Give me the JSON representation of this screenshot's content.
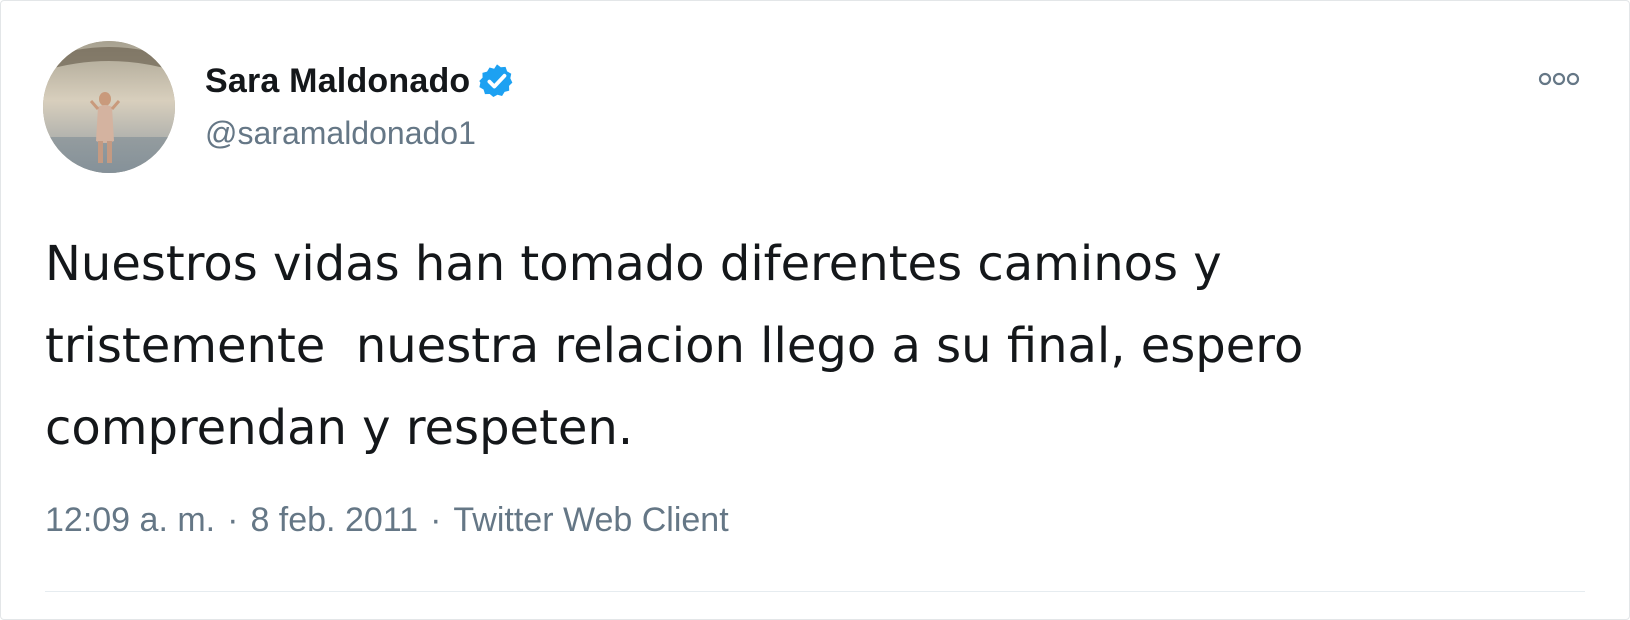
{
  "tweet": {
    "author": {
      "display_name": "Sara Maldonado",
      "handle": "@saramaldonado1",
      "verified": true,
      "avatar_icon": "profile-photo"
    },
    "text": "Nuestros vidas han tomado diferentes caminos y\ntristemente  nuestra relacion llego a su final, espero\ncomprendan y respeten.",
    "time": "12:09 a. m.",
    "date": "8 feb. 2011",
    "separator": "·",
    "source": "Twitter Web Client",
    "more_icon": "more-options-icon"
  },
  "colors": {
    "text_primary": "#14171a",
    "text_secondary": "#657786",
    "verified_blue": "#1da1f2",
    "border": "#e3e6e8"
  }
}
